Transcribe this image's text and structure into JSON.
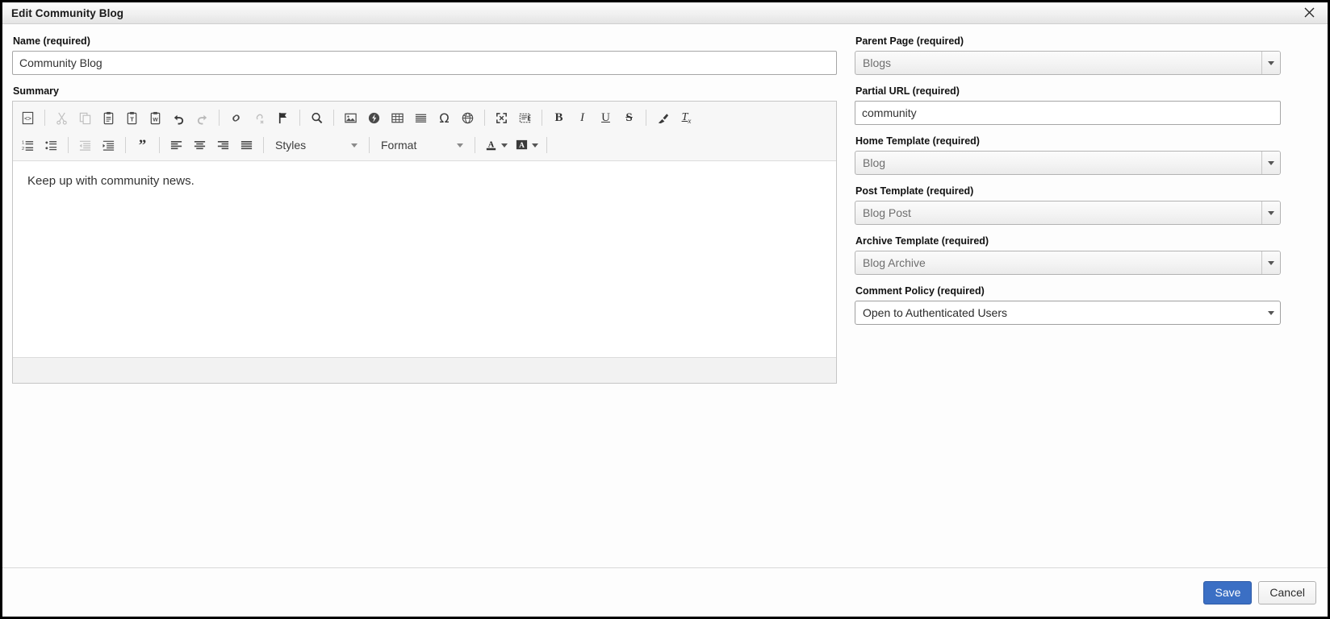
{
  "window": {
    "title": "Edit Community Blog",
    "close_icon": "close-icon"
  },
  "left": {
    "name_label": "Name (required)",
    "name_value": "Community Blog",
    "summary_label": "Summary",
    "editor_body_text": "Keep up with community news."
  },
  "toolbar": {
    "row1": [
      {
        "name": "source-icon",
        "label": "Source",
        "disabled": false
      },
      {
        "sep": true
      },
      {
        "name": "cut-icon",
        "label": "Cut",
        "disabled": true
      },
      {
        "name": "copy-icon",
        "label": "Copy",
        "disabled": true
      },
      {
        "name": "paste-icon",
        "label": "Paste",
        "disabled": false
      },
      {
        "name": "paste-text-icon",
        "label": "Paste as plain text",
        "disabled": false
      },
      {
        "name": "paste-word-icon",
        "label": "Paste from Word",
        "disabled": false
      },
      {
        "name": "undo-icon",
        "label": "Undo",
        "disabled": false
      },
      {
        "name": "redo-icon",
        "label": "Redo",
        "disabled": true
      },
      {
        "sep": true
      },
      {
        "name": "link-icon",
        "label": "Link",
        "disabled": false
      },
      {
        "name": "unlink-icon",
        "label": "Unlink",
        "disabled": true
      },
      {
        "name": "anchor-flag-icon",
        "label": "Anchor",
        "disabled": false
      },
      {
        "sep": true
      },
      {
        "name": "search-icon",
        "label": "Find",
        "disabled": false
      },
      {
        "sep": true
      },
      {
        "name": "image-icon",
        "label": "Image",
        "disabled": false
      },
      {
        "name": "flash-icon",
        "label": "Flash",
        "disabled": false
      },
      {
        "name": "table-icon",
        "label": "Table",
        "disabled": false
      },
      {
        "name": "horizontal-rule-icon",
        "label": "Horizontal Line",
        "disabled": false
      },
      {
        "name": "special-char-icon",
        "label": "Special Character",
        "disabled": false
      },
      {
        "name": "globe-icon",
        "label": "IFrame",
        "disabled": false
      },
      {
        "sep": true
      },
      {
        "name": "maximize-icon",
        "label": "Maximize",
        "disabled": false
      },
      {
        "name": "show-blocks-icon",
        "label": "Show Blocks",
        "disabled": false
      },
      {
        "sep": true
      },
      {
        "name": "bold-icon",
        "label": "Bold",
        "disabled": false
      },
      {
        "name": "italic-icon",
        "label": "Italic",
        "disabled": false
      },
      {
        "name": "underline-icon",
        "label": "Underline",
        "disabled": false
      },
      {
        "name": "strikethrough-icon",
        "label": "Strikethrough",
        "disabled": false
      },
      {
        "sep": true
      },
      {
        "name": "remove-format-icon",
        "label": "Remove Format",
        "disabled": false
      },
      {
        "name": "clear-text-format-icon",
        "label": "Clear Text Formatting",
        "disabled": false
      }
    ],
    "row2": [
      {
        "name": "numbered-list-icon",
        "label": "Insert/Remove Numbered List",
        "disabled": false
      },
      {
        "name": "bulleted-list-icon",
        "label": "Insert/Remove Bulleted List",
        "disabled": false
      },
      {
        "sep": true
      },
      {
        "name": "outdent-icon",
        "label": "Decrease Indent",
        "disabled": true
      },
      {
        "name": "indent-icon",
        "label": "Increase Indent",
        "disabled": false
      },
      {
        "sep": true
      },
      {
        "name": "blockquote-icon",
        "label": "Block Quote",
        "disabled": false
      },
      {
        "sep": true
      },
      {
        "name": "align-left-icon",
        "label": "Align Left",
        "disabled": false
      },
      {
        "name": "align-center-icon",
        "label": "Center",
        "disabled": false
      },
      {
        "name": "align-right-icon",
        "label": "Align Right",
        "disabled": false
      },
      {
        "name": "align-justify-icon",
        "label": "Justify",
        "disabled": false
      }
    ],
    "styles_label": "Styles",
    "format_label": "Format",
    "text_color_icon": "text-color-icon",
    "bg_color_icon": "background-color-icon"
  },
  "right": {
    "fields": [
      {
        "label": "Parent Page (required)",
        "value": "Blogs",
        "type": "select",
        "state": "disabled"
      },
      {
        "label": "Partial URL (required)",
        "value": "community",
        "type": "text"
      },
      {
        "label": "Home Template (required)",
        "value": "Blog",
        "type": "select",
        "state": "disabled"
      },
      {
        "label": "Post Template (required)",
        "value": "Blog Post",
        "type": "select",
        "state": "disabled"
      },
      {
        "label": "Archive Template (required)",
        "value": "Blog Archive",
        "type": "select",
        "state": "disabled"
      },
      {
        "label": "Comment Policy (required)",
        "value": "Open to Authenticated Users",
        "type": "select",
        "state": "enabled"
      }
    ]
  },
  "footer": {
    "save_label": "Save",
    "cancel_label": "Cancel"
  },
  "colors": {
    "primary_button": "#3b6fc4",
    "toolbar_bg": "#f7f7f7",
    "titlebar_bg": "#f0f0f0"
  }
}
